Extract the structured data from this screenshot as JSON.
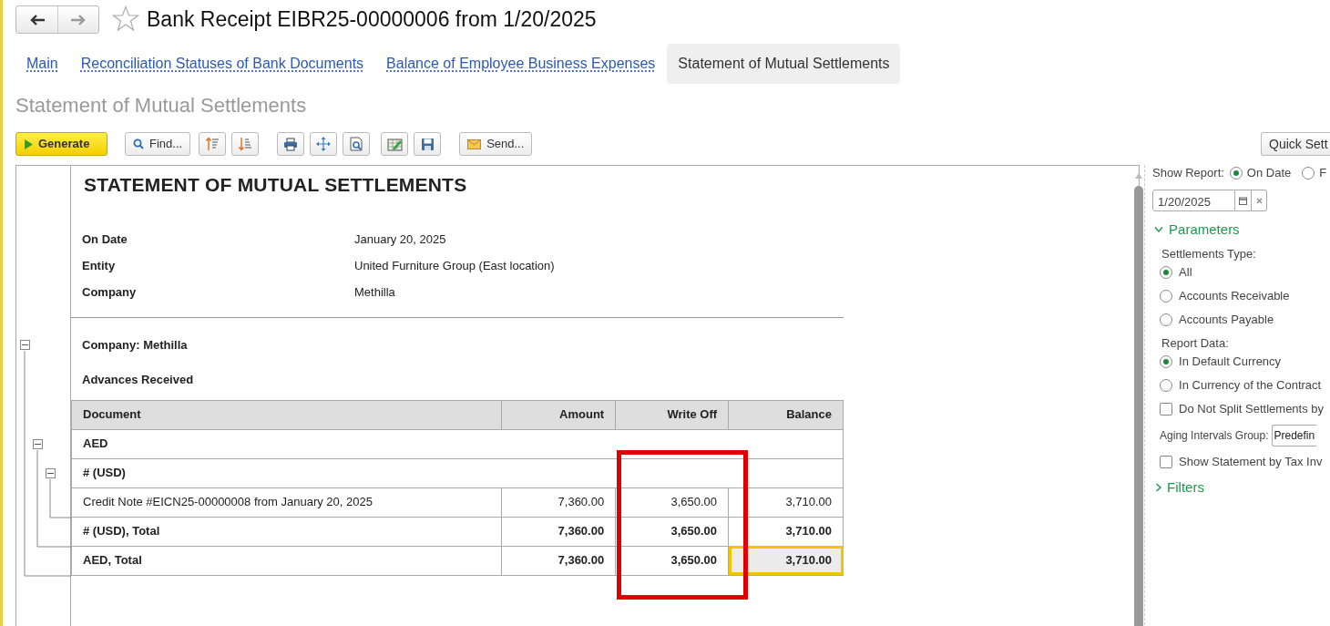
{
  "window": {
    "title": "Bank Receipt EIBR25-00000006 from 1/20/2025"
  },
  "tabs": [
    {
      "label": "Main",
      "selected": false
    },
    {
      "label": "Reconciliation Statuses of Bank Documents",
      "selected": false
    },
    {
      "label": "Balance of Employee Business Expenses",
      "selected": false
    },
    {
      "label": "Statement of Mutual Settlements",
      "selected": true
    }
  ],
  "section_title": "Statement of Mutual Settlements",
  "toolbar": [
    {
      "kind": "primary",
      "label": "Generate"
    },
    {
      "kind": "text",
      "label": "Find..."
    },
    {
      "kind": "icon"
    },
    {
      "kind": "icon"
    },
    {
      "kind": "icon"
    },
    {
      "kind": "icon"
    },
    {
      "kind": "icon"
    },
    {
      "kind": "icon"
    },
    {
      "kind": "icon"
    },
    {
      "kind": "text",
      "label": "Send..."
    }
  ],
  "quick_settings_button": "Quick Sett",
  "report": {
    "title": "STATEMENT OF MUTUAL SETTLEMENTS",
    "fields": [
      {
        "label": "On Date",
        "value": "January 20, 2025"
      },
      {
        "label": "Entity",
        "value": "United Furniture Group (East location)"
      },
      {
        "label": "Company",
        "value": "Methilla"
      }
    ],
    "company": {
      "label": "Company: Methilla",
      "expanded": true
    },
    "section": "Advances Received",
    "columns": [
      "Document",
      "Amount",
      "Write Off",
      "Balance"
    ],
    "groups": [
      {
        "cells": [
          {
            "text": "AED",
            "selected": false
          }
        ],
        "expanded": true,
        "children": [
          {
            "cells": [
              {
                "text": "#  (USD)",
                "selected": false
              }
            ],
            "expanded": true,
            "children": [
              {
                "cells": [
                  {
                    "text": "Credit Note #EICN25-00000008 from January 20, 2025",
                    "selected": false
                  },
                  {
                    "text": "7,360.00",
                    "selected": false
                  },
                  {
                    "text": "3,650.00",
                    "selected": false
                  },
                  {
                    "text": "3,710.00",
                    "selected": false
                  }
                ]
              }
            ],
            "total": {
              "cells": [
                {
                  "text": "#  (USD), Total",
                  "selected": false
                },
                {
                  "text": "7,360.00",
                  "selected": false
                },
                {
                  "text": "3,650.00",
                  "selected": false
                },
                {
                  "text": "3,710.00",
                  "selected": false
                }
              ]
            }
          }
        ],
        "total": {
          "cells": [
            {
              "text": "AED, Total",
              "selected": false
            },
            {
              "text": "7,360.00",
              "selected": false
            },
            {
              "text": "3,650.00",
              "selected": false
            },
            {
              "text": "3,710.00",
              "selected": true
            }
          ]
        }
      }
    ]
  },
  "settings": {
    "show_report_label": "Show Report:",
    "show_report_options": [
      {
        "label": "On Date",
        "selected": true
      },
      {
        "label": "F",
        "selected": false
      }
    ],
    "date": "1/20/2025",
    "parameters": {
      "label": "Parameters",
      "expanded": true
    },
    "items": [
      {
        "kind": "label",
        "text": "Settlements Type:"
      },
      {
        "kind": "radio",
        "text": "All",
        "selected": true
      },
      {
        "kind": "radio",
        "text": "Accounts Receivable",
        "selected": false
      },
      {
        "kind": "radio",
        "text": "Accounts Payable",
        "selected": false
      },
      {
        "kind": "label",
        "text": "Report Data:"
      },
      {
        "kind": "radio",
        "text": "In Default Currency",
        "selected": true
      },
      {
        "kind": "radio",
        "text": "In Currency of the Contract",
        "selected": false
      },
      {
        "kind": "checkbox",
        "text": "Do Not Split Settlements by",
        "checked": false
      },
      {
        "kind": "select",
        "text": "Aging Intervals Group:",
        "value": "Predefin"
      },
      {
        "kind": "checkbox",
        "text": "Show Statement by Tax Inv",
        "checked": false
      }
    ],
    "filters": {
      "label": "Filters",
      "expanded": false
    }
  }
}
